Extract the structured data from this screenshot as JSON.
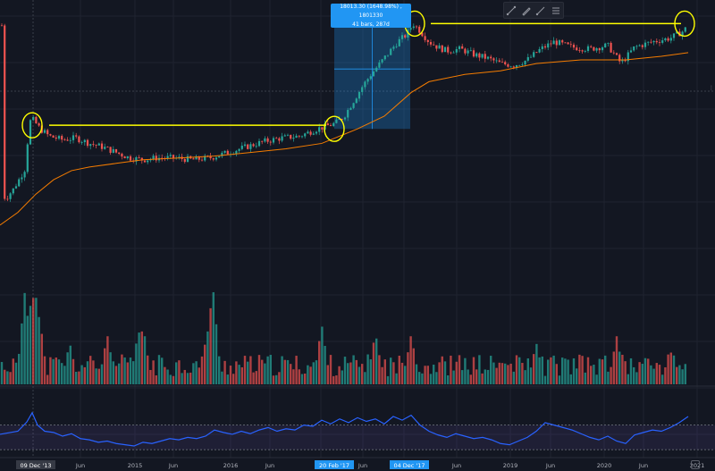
{
  "toolbar": {
    "icons": [
      "trend-line-icon",
      "brush-icon",
      "ray-icon",
      "more-tools-icon"
    ]
  },
  "tooltip": {
    "line1": "18013.30 (1648.98%) , 1801330",
    "line2": "41 bars, 287d"
  },
  "colors": {
    "background": "#131722",
    "up": "#26a69a",
    "down": "#ef5350",
    "ma": "#f57c00",
    "annotation": "#ffff00",
    "rsi": "#2962ff",
    "measure": "#2196f3"
  },
  "chart_data": [
    {
      "type": "candlestick",
      "series": [
        {
          "name": "",
          "points": [
            [
              3.6,
              2.3
            ],
            [
              6,
              1.9
            ],
            [
              10,
              2.2
            ],
            [
              14,
              2.4
            ],
            [
              20,
              2.9
            ],
            [
              28,
              3.6
            ],
            [
              33,
              6.2
            ],
            [
              37,
              6.3
            ],
            [
              45,
              5.8
            ],
            [
              55,
              5.4
            ],
            [
              70,
              5.2
            ],
            [
              85,
              5.3
            ],
            [
              100,
              5.0
            ],
            [
              115,
              4.8
            ],
            [
              130,
              4.5
            ],
            [
              145,
              4.2
            ],
            [
              160,
              4.1
            ],
            [
              175,
              4.2
            ],
            [
              195,
              4.2
            ],
            [
              215,
              4.1
            ],
            [
              235,
              4.2
            ],
            [
              255,
              4.5
            ],
            [
              275,
              4.8
            ],
            [
              295,
              5.1
            ],
            [
              315,
              5.3
            ],
            [
              335,
              5.4
            ],
            [
              355,
              5.8
            ],
            [
              375,
              6.1
            ],
            [
              385,
              6.5
            ],
            [
              395,
              7.3
            ],
            [
              405,
              8.1
            ],
            [
              415,
              8.8
            ],
            [
              425,
              9.4
            ],
            [
              435,
              10.0
            ],
            [
              445,
              10.6
            ],
            [
              455,
              11.0
            ],
            [
              462,
              11.6
            ],
            [
              470,
              11.2
            ],
            [
              480,
              10.6
            ],
            [
              490,
              10.3
            ],
            [
              500,
              10.1
            ],
            [
              515,
              10.2
            ],
            [
              530,
              9.9
            ],
            [
              545,
              9.7
            ],
            [
              560,
              9.4
            ],
            [
              575,
              9.3
            ],
            [
              590,
              9.6
            ],
            [
              605,
              10.2
            ],
            [
              620,
              10.6
            ],
            [
              640,
              10.3
            ],
            [
              660,
              10.2
            ],
            [
              680,
              10.4
            ],
            [
              695,
              9.4
            ],
            [
              710,
              10.3
            ],
            [
              730,
              10.6
            ],
            [
              750,
              10.8
            ],
            [
              765,
              11.2
            ],
            [
              770,
              11.5
            ]
          ]
        },
        {
          "name": "",
          "points": [
            [
              0,
              0.5
            ],
            [
              20,
              1.2
            ],
            [
              40,
              2.2
            ],
            [
              60,
              3.0
            ],
            [
              80,
              3.5
            ],
            [
              100,
              3.7
            ],
            [
              130,
              3.9
            ],
            [
              160,
              4.1
            ],
            [
              200,
              4.2
            ],
            [
              240,
              4.3
            ],
            [
              280,
              4.5
            ],
            [
              320,
              4.7
            ],
            [
              360,
              5.0
            ],
            [
              400,
              5.8
            ],
            [
              430,
              6.5
            ],
            [
              460,
              7.8
            ],
            [
              480,
              8.4
            ],
            [
              520,
              8.8
            ],
            [
              560,
              9.0
            ],
            [
              600,
              9.4
            ],
            [
              650,
              9.6
            ],
            [
              700,
              9.6
            ],
            [
              740,
              9.8
            ],
            [
              770,
              10.0
            ]
          ]
        }
      ],
      "x_tick_labels": [
        "09 Dec '13",
        "Jun",
        "2015",
        "Jun",
        "2016",
        "Jun",
        "20",
        "20 Feb '17",
        "Jun",
        "04 Dec '17",
        "Jun",
        "2019",
        "Jun",
        "2020",
        "Jun",
        "2021"
      ],
      "annotations": [
        {
          "type": "horizontal-line",
          "y": 6.0,
          "x_range": [
            55,
            365
          ]
        },
        {
          "type": "horizontal-line",
          "y": 11.6,
          "x_range": [
            482,
            762
          ]
        },
        {
          "type": "circle",
          "x": 36,
          "y": 6.0
        },
        {
          "type": "circle",
          "x": 374,
          "y": 5.8
        },
        {
          "type": "circle",
          "x": 464,
          "y": 11.6
        },
        {
          "type": "circle",
          "x": 766,
          "y": 11.6
        }
      ],
      "measurement": {
        "x_range": [
          374,
          459
        ],
        "y_range": [
          5.8,
          12.4
        ],
        "label_line1": "18013.30 (1648.98%) , 1801330",
        "label_line2": "41 bars, 287d"
      },
      "xlim": [
        0,
        800
      ],
      "ylim": [
        0,
        12.9
      ]
    },
    {
      "type": "bar",
      "series": [
        {
          "name": "volume"
        }
      ],
      "seed": 11,
      "spikes": [
        [
          28,
          0.95
        ],
        [
          36,
          0.98
        ],
        [
          40,
          0.9
        ],
        [
          44,
          0.7
        ],
        [
          78,
          0.42
        ],
        [
          120,
          0.5
        ],
        [
          155,
          0.55
        ],
        [
          160,
          0.6
        ],
        [
          238,
          1.0
        ],
        [
          232,
          0.55
        ],
        [
          360,
          0.6
        ],
        [
          420,
          0.52
        ],
        [
          460,
          0.5
        ],
        [
          600,
          0.42
        ],
        [
          690,
          0.48
        ],
        [
          752,
          0.36
        ]
      ]
    },
    {
      "type": "line",
      "series": [
        {
          "name": "",
          "points": [
            [
              0,
              55
            ],
            [
              20,
              60
            ],
            [
              30,
              75
            ],
            [
              36,
              90
            ],
            [
              42,
              70
            ],
            [
              50,
              60
            ],
            [
              60,
              58
            ],
            [
              70,
              52
            ],
            [
              80,
              56
            ],
            [
              90,
              48
            ],
            [
              100,
              46
            ],
            [
              110,
              42
            ],
            [
              120,
              44
            ],
            [
              130,
              40
            ],
            [
              140,
              38
            ],
            [
              150,
              36
            ],
            [
              160,
              42
            ],
            [
              170,
              40
            ],
            [
              180,
              44
            ],
            [
              190,
              48
            ],
            [
              200,
              46
            ],
            [
              210,
              50
            ],
            [
              220,
              48
            ],
            [
              230,
              52
            ],
            [
              240,
              62
            ],
            [
              250,
              58
            ],
            [
              260,
              55
            ],
            [
              270,
              60
            ],
            [
              280,
              56
            ],
            [
              290,
              62
            ],
            [
              300,
              66
            ],
            [
              310,
              60
            ],
            [
              320,
              64
            ],
            [
              330,
              62
            ],
            [
              340,
              70
            ],
            [
              350,
              68
            ],
            [
              360,
              78
            ],
            [
              370,
              72
            ],
            [
              380,
              80
            ],
            [
              390,
              74
            ],
            [
              400,
              82
            ],
            [
              410,
              76
            ],
            [
              420,
              80
            ],
            [
              430,
              72
            ],
            [
              440,
              84
            ],
            [
              450,
              78
            ],
            [
              460,
              86
            ],
            [
              470,
              70
            ],
            [
              480,
              60
            ],
            [
              490,
              54
            ],
            [
              500,
              50
            ],
            [
              510,
              56
            ],
            [
              520,
              52
            ],
            [
              530,
              48
            ],
            [
              540,
              50
            ],
            [
              550,
              46
            ],
            [
              560,
              40
            ],
            [
              570,
              38
            ],
            [
              580,
              44
            ],
            [
              590,
              50
            ],
            [
              600,
              60
            ],
            [
              610,
              74
            ],
            [
              620,
              70
            ],
            [
              630,
              66
            ],
            [
              640,
              62
            ],
            [
              650,
              56
            ],
            [
              660,
              50
            ],
            [
              670,
              46
            ],
            [
              680,
              52
            ],
            [
              690,
              44
            ],
            [
              700,
              40
            ],
            [
              710,
              54
            ],
            [
              720,
              58
            ],
            [
              730,
              62
            ],
            [
              740,
              60
            ],
            [
              750,
              66
            ],
            [
              760,
              74
            ],
            [
              770,
              84
            ]
          ]
        }
      ],
      "levels": [
        30,
        70
      ],
      "ylim": [
        20,
        100
      ]
    }
  ]
}
